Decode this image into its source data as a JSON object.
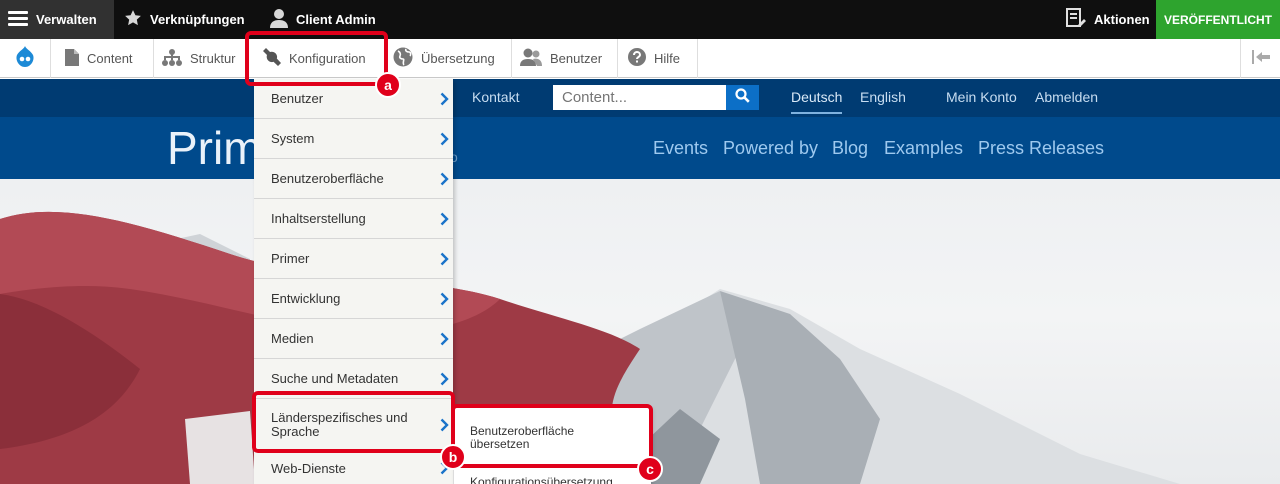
{
  "toolbar": {
    "manage": "Verwalten",
    "shortcuts": "Verknüpfungen",
    "user": "Client Admin",
    "actions": "Aktionen",
    "publish": "VERÖFFENTLICHT"
  },
  "tray": {
    "items": [
      "Content",
      "Struktur",
      "Konfiguration",
      "Übersetzung",
      "Benutzer",
      "Hilfe"
    ]
  },
  "site": {
    "top_links": {
      "kontakt": "Kontakt",
      "lang_de": "Deutsch",
      "lang_en": "English",
      "account": "Mein Konto",
      "logout": "Abmelden"
    },
    "search_placeholder": "Content...",
    "title": "Prim",
    "subtitle": "o",
    "main_nav": [
      "Events",
      "Powered by",
      "Blog",
      "Examples",
      "Press Releases"
    ]
  },
  "config_menu": [
    "Benutzer",
    "System",
    "Benutzeroberfläche",
    "Inhaltserstellung",
    "Primer",
    "Entwicklung",
    "Medien",
    "Suche und Metadaten",
    "Länderspezifisches und Sprache",
    "Web-Dienste"
  ],
  "submenu": [
    "Benutzeroberfläche übersetzen",
    "Konfigurationsübersetzung"
  ],
  "annotations": [
    "a",
    "b",
    "c"
  ],
  "colors": {
    "highlight": "#e0001b",
    "publish": "#2ea42e",
    "site_header": "#004a8c",
    "admin_bar": "#0f0f0f"
  }
}
